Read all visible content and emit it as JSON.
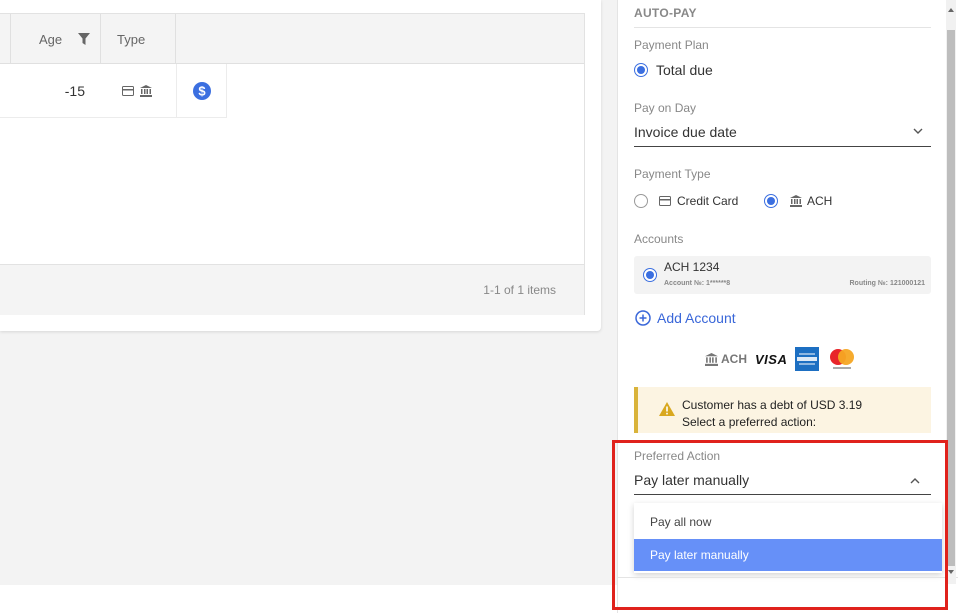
{
  "grid": {
    "columns": {
      "age": "Age",
      "type": "Type"
    },
    "rows": [
      {
        "age": "-15",
        "type_icons": [
          "credit-card-icon",
          "bank-icon"
        ],
        "action_icon": "dollar-icon"
      }
    ],
    "pager": "1-1 of 1 items"
  },
  "autopay": {
    "title": "AUTO-PAY",
    "payment_plan": {
      "label": "Payment Plan",
      "option": "Total due"
    },
    "pay_on_day": {
      "label": "Pay on Day",
      "value": "Invoice due date"
    },
    "payment_type": {
      "label": "Payment Type",
      "options": [
        "Credit Card",
        "ACH"
      ],
      "selected": "ACH"
    },
    "accounts": {
      "label": "Accounts",
      "items": [
        {
          "name": "ACH 1234",
          "account_no": "Account №: 1******8",
          "routing_no": "Routing №: 121000121"
        }
      ]
    },
    "add_account": "Add Account",
    "logos": {
      "ach": "ACH",
      "visa": "VISA"
    },
    "warning": {
      "line1": "Customer has a debt of USD 3.19",
      "line2": "Select a preferred action:"
    },
    "preferred_action": {
      "label": "Preferred Action",
      "value": "Pay later manually",
      "options": [
        "Pay all now",
        "Pay later manually"
      ],
      "selected_index": 1
    }
  },
  "colors": {
    "accent": "#3b6fe0",
    "highlight": "#e0221c",
    "menu_selected": "#6690f8",
    "warning_bar": "#d9b33a"
  }
}
